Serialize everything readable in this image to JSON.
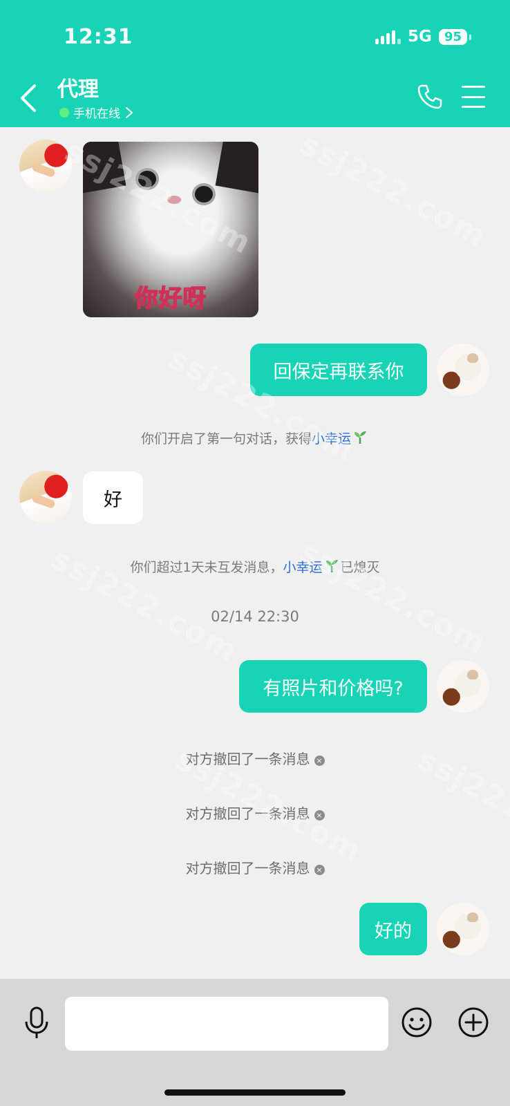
{
  "status_bar": {
    "time": "12:31",
    "network": "5G",
    "battery": "95"
  },
  "header": {
    "title": "代理",
    "status": "手机在线"
  },
  "messages": {
    "sticker_text": "你好呀",
    "msg1": "回保定再联系你",
    "system1": {
      "prefix": "你们开启了第一句对话，获得",
      "highlight": "小幸运"
    },
    "msg2": "好",
    "system2": {
      "prefix": "你们超过1天未互发消息，",
      "highlight": "小幸运",
      "suffix": "已熄灭"
    },
    "timestamp": "02/14 22:30",
    "msg3": "有照片和价格吗?",
    "recall1": "对方撤回了一条消息",
    "recall2": "对方撤回了一条消息",
    "recall3": "对方撤回了一条消息",
    "msg4": "好的"
  },
  "input": {
    "placeholder": ""
  },
  "watermark": "ssj222.com",
  "colors": {
    "accent": "#17d4b6",
    "link": "#2b6fd0",
    "online": "#5ef07a"
  }
}
